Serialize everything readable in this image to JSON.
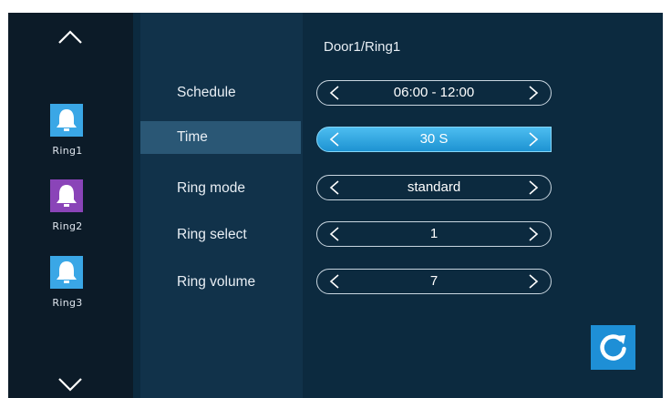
{
  "rail": {
    "up_icon": "chevron-up-icon",
    "down_icon": "chevron-down-icon",
    "items": [
      {
        "label": "Ring1",
        "number": "1",
        "icon": "bell-icon",
        "color": "#3aa7e6"
      },
      {
        "label": "Ring2",
        "number": "2",
        "icon": "bell-icon",
        "color": "#8a44b8"
      },
      {
        "label": "Ring3",
        "number": "3",
        "icon": "bell-icon",
        "color": "#3aa7e6"
      }
    ]
  },
  "menu": {
    "items": [
      {
        "label": "Schedule"
      },
      {
        "label": "Time",
        "active": true
      },
      {
        "label": "Ring mode"
      },
      {
        "label": "Ring select"
      },
      {
        "label": "Ring volume"
      }
    ]
  },
  "settings": {
    "header": "Door1/Ring1",
    "rows": [
      {
        "value": "06:00 - 12:00"
      },
      {
        "value": "30 S",
        "active": true
      },
      {
        "value": "standard"
      },
      {
        "value": "1"
      },
      {
        "value": "7"
      }
    ]
  },
  "actions": {
    "refresh_icon": "refresh-icon"
  },
  "colors": {
    "screen_bg": "#0c2a3f",
    "rail_bg": "#0c1b28",
    "menu_bg": "#11324a",
    "active_row": "#2a5775",
    "accent": "#1e8fd6"
  }
}
